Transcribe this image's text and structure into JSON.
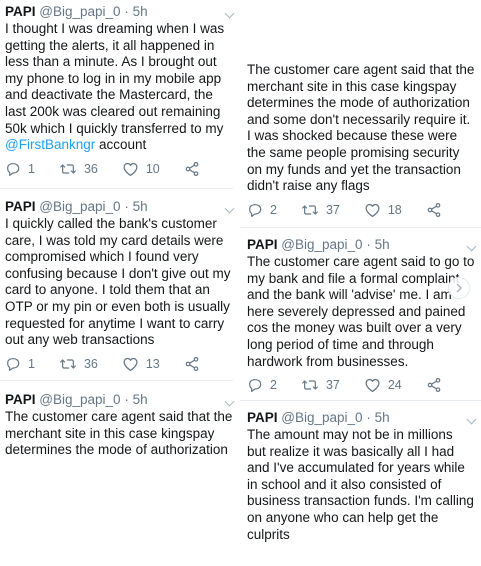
{
  "tweets": [
    {
      "name": "PAPI",
      "handle": "@Big_papi_0",
      "separator": "·",
      "time": "5h",
      "text_before_link": "I thought I was dreaming when I was getting the alerts, it all happened in less than a minute. As I brought out my phone to log in in my mobile app and deactivate the Mastercard, the last 200k was cleared out remaining 50k which I quickly transferred to my ",
      "link": "@FirstBankngr",
      "text_after_link": " account",
      "replies": "1",
      "retweets": "36",
      "likes": "10"
    },
    {
      "text": "The customer care agent said that the merchant site in this case kingspay determines the mode of authorization and some don't necessarily require it. I was shocked because these were the same people promising security on my funds and yet the transaction didn't raise any flags",
      "replies": "2",
      "retweets": "37",
      "likes": "18"
    },
    {
      "name": "PAPI",
      "handle": "@Big_papi_0",
      "separator": "·",
      "time": "5h",
      "text": "I quickly called the bank's customer care, I was told my card details were compromised which I found very confusing because I don't give out my card to anyone. I told them that an OTP or my pin or even both is usually requested for anytime I want to carry out any web transactions",
      "replies": "1",
      "retweets": "36",
      "likes": "13"
    },
    {
      "name": "PAPI",
      "handle": "@Big_papi_0",
      "separator": "·",
      "time": "5h",
      "text": "The customer care agent said to go to my bank and file a formal complaint and the bank will 'advise' me. I am here severely depressed and pained cos the money was built over a very long period of time and through hardwork from businesses.",
      "replies": "2",
      "retweets": "37",
      "likes": "24"
    },
    {
      "name": "PAPI",
      "handle": "@Big_papi_0",
      "separator": "·",
      "time": "5h",
      "text": "The customer care agent said that the merchant site in this case kingspay determines the mode of authorization"
    },
    {
      "name": "PAPI",
      "handle": "@Big_papi_0",
      "separator": "·",
      "time": "5h",
      "text": "The amount may not be in millions but realize it was basically all I had and I've accumulated for years while in school and it also consisted of business transaction funds. I'm calling on anyone who can help get the culprits"
    }
  ],
  "icons": {
    "reply": "reply-icon",
    "retweet": "retweet-icon",
    "like": "heart-icon",
    "share": "share-icon",
    "more": "chevron-down-icon",
    "next": "chevron-right-icon"
  },
  "colors": {
    "text": "#14171a",
    "muted": "#657786",
    "link": "#1da1f2",
    "divider": "#e6ecf0"
  }
}
